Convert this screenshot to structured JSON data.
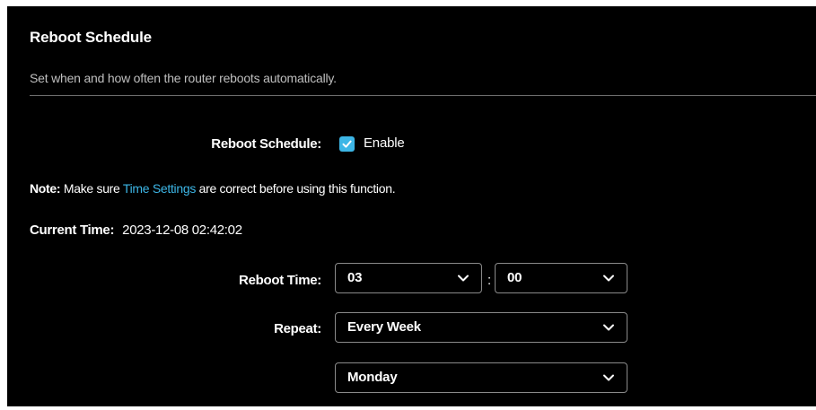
{
  "section": {
    "title": "Reboot Schedule",
    "description": "Set when and how often the router reboots automatically."
  },
  "schedule": {
    "label": "Reboot Schedule:",
    "checkbox_checked": true,
    "checkbox_label": "Enable"
  },
  "note": {
    "prefix": "Note:",
    "text_before": " Make sure ",
    "link": "Time Settings",
    "text_after": " are correct before using this function."
  },
  "current_time": {
    "label": "Current Time:",
    "value": "2023-12-08 02:42:02"
  },
  "reboot_time": {
    "label": "Reboot Time:",
    "hour": "03",
    "separator": ":",
    "minute": "00"
  },
  "repeat": {
    "label": "Repeat:",
    "frequency": "Every Week",
    "day": "Monday"
  },
  "colors": {
    "background": "#000000",
    "accent": "#3db6e6",
    "text": "#ffffff",
    "muted_text": "#bfbfbf",
    "divider": "#6e6e6e",
    "select_border": "#8a8a8a"
  },
  "icons": {
    "checkbox": "checkmark-icon",
    "dropdown": "chevron-down-icon"
  }
}
